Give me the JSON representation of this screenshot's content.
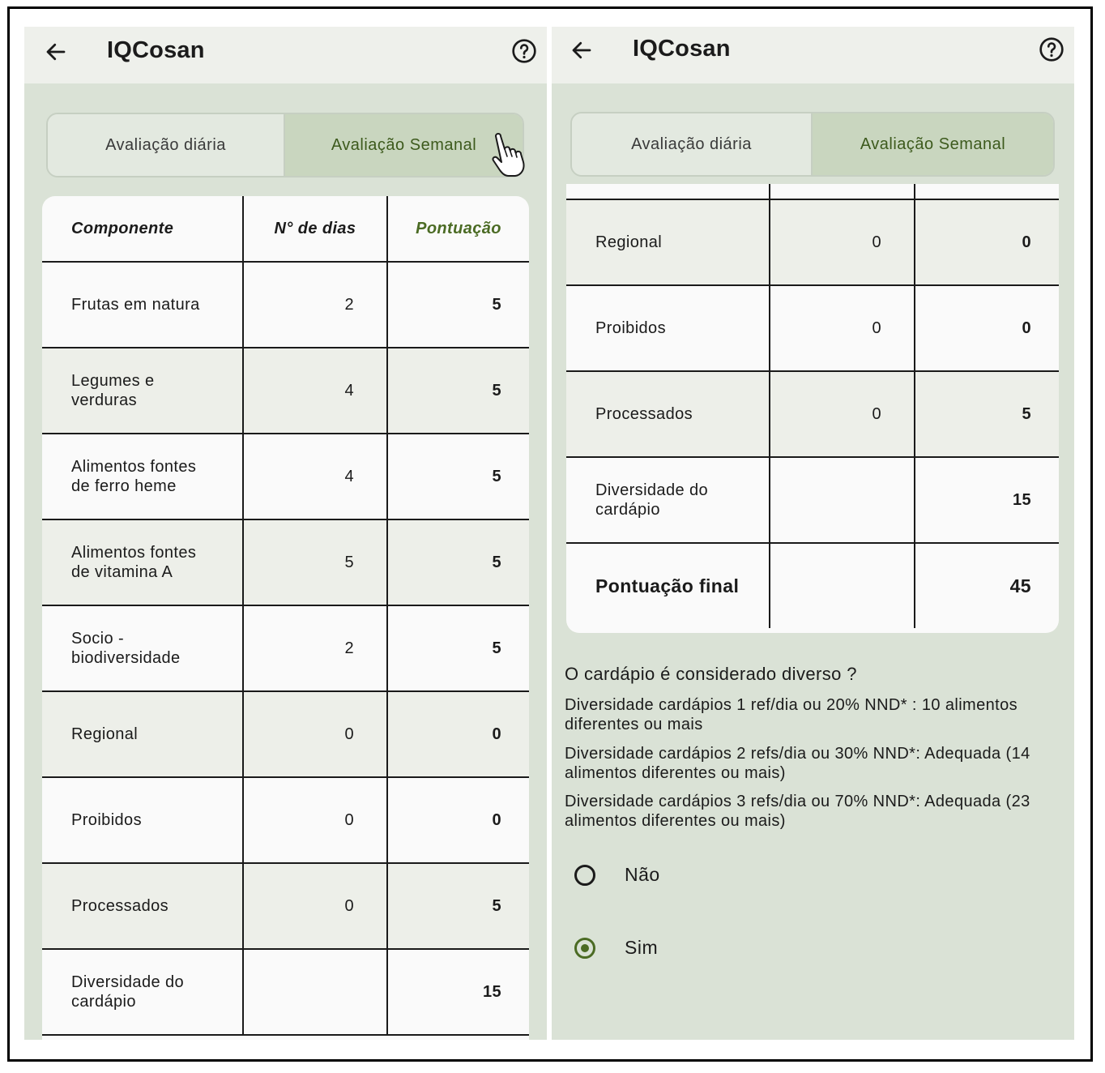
{
  "app": {
    "title": "IQCosan"
  },
  "tabs": {
    "daily": "Avaliação diária",
    "weekly": "Avaliação Semanal"
  },
  "table": {
    "headers": [
      "Componente",
      "N° de dias",
      "Pontuação"
    ],
    "rows": [
      {
        "component": "Frutas em natura",
        "days": "2",
        "score": "5"
      },
      {
        "component": "Legumes e verduras",
        "days": "4",
        "score": "5"
      },
      {
        "component": "Alimentos fontes de ferro heme",
        "days": "4",
        "score": "5"
      },
      {
        "component": "Alimentos fontes de vitamina A",
        "days": "5",
        "score": "5"
      },
      {
        "component": "Socio -biodiversidade",
        "days": "2",
        "score": "5"
      },
      {
        "component": "Regional",
        "days": "0",
        "score": "0"
      },
      {
        "component": "Proibidos",
        "days": "0",
        "score": "0"
      },
      {
        "component": "Processados",
        "days": "0",
        "score": "5"
      },
      {
        "component": "Diversidade do cardápio",
        "days": "",
        "score": "15"
      }
    ],
    "final": {
      "label": "Pontuação final",
      "score": "45"
    }
  },
  "diversity": {
    "question": "O cardápio é considerado diverso ?",
    "notes": [
      "Diversidade cardápios 1 ref/dia ou 20%  NND* : 10 alimentos diferentes ou mais",
      "Diversidade cardápios 2 refs/dia ou 30%  NND*: Adequada (14 alimentos diferentes ou mais)",
      "Diversidade cardápios 3 refs/dia ou 70% NND*: Adequada (23 alimentos diferentes ou mais)"
    ],
    "options": [
      {
        "label": "Não",
        "selected": false
      },
      {
        "label": "Sim",
        "selected": true
      }
    ]
  },
  "colors": {
    "accent": "#4b6b24",
    "background": "#dae2d6",
    "appbar": "#eef0eb"
  },
  "icons": {
    "back": "arrow-left-icon",
    "help": "help-circle-icon",
    "cursor": "hand-pointer-icon"
  }
}
